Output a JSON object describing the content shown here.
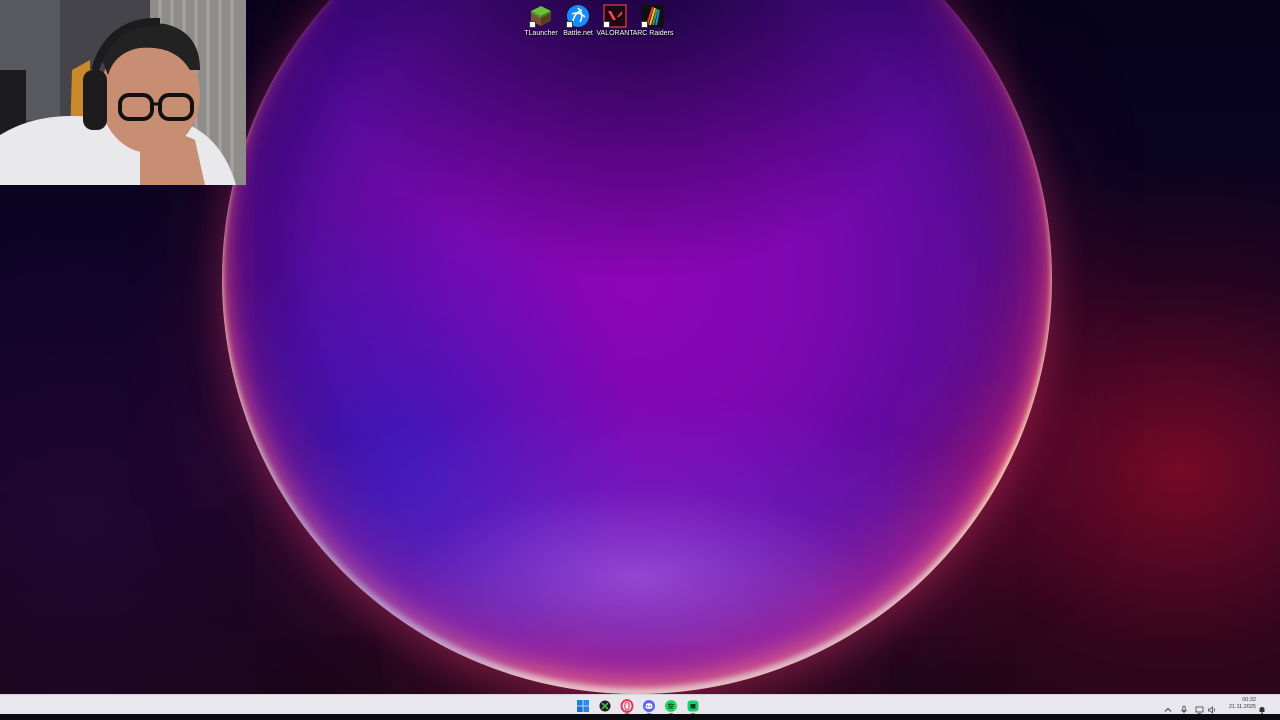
{
  "desktop": {
    "icons": [
      {
        "label": "TLauncher",
        "icon": "tlauncher-grass-block-icon"
      },
      {
        "label": "Battle.net",
        "icon": "battlenet-icon"
      },
      {
        "label": "VALORANT",
        "icon": "valorant-icon"
      },
      {
        "label": "ARC Raiders",
        "icon": "arc-raiders-icon"
      }
    ]
  },
  "webcam": {
    "description_icon": "webcam-feed"
  },
  "taskbar": {
    "pinned": [
      {
        "name": "start",
        "icon": "windows-start-icon"
      },
      {
        "name": "xbox",
        "icon": "xbox-icon"
      },
      {
        "name": "opera-gx",
        "icon": "opera-gx-icon"
      },
      {
        "name": "discord",
        "icon": "discord-icon"
      },
      {
        "name": "spotify",
        "icon": "spotify-icon"
      },
      {
        "name": "app",
        "icon": "green-app-icon"
      }
    ],
    "tray": {
      "icons": [
        "chevron-up-icon",
        "microphone-icon",
        "network-icon",
        "speaker-icon",
        "notification-icon"
      ]
    },
    "clock": {
      "time": "00:32",
      "date": "21.11.2025"
    }
  },
  "colors": {
    "taskbar_bg": "#e9e6ee",
    "orb_core": "#8d06b6",
    "orb_rim": "#ff6a5a"
  }
}
